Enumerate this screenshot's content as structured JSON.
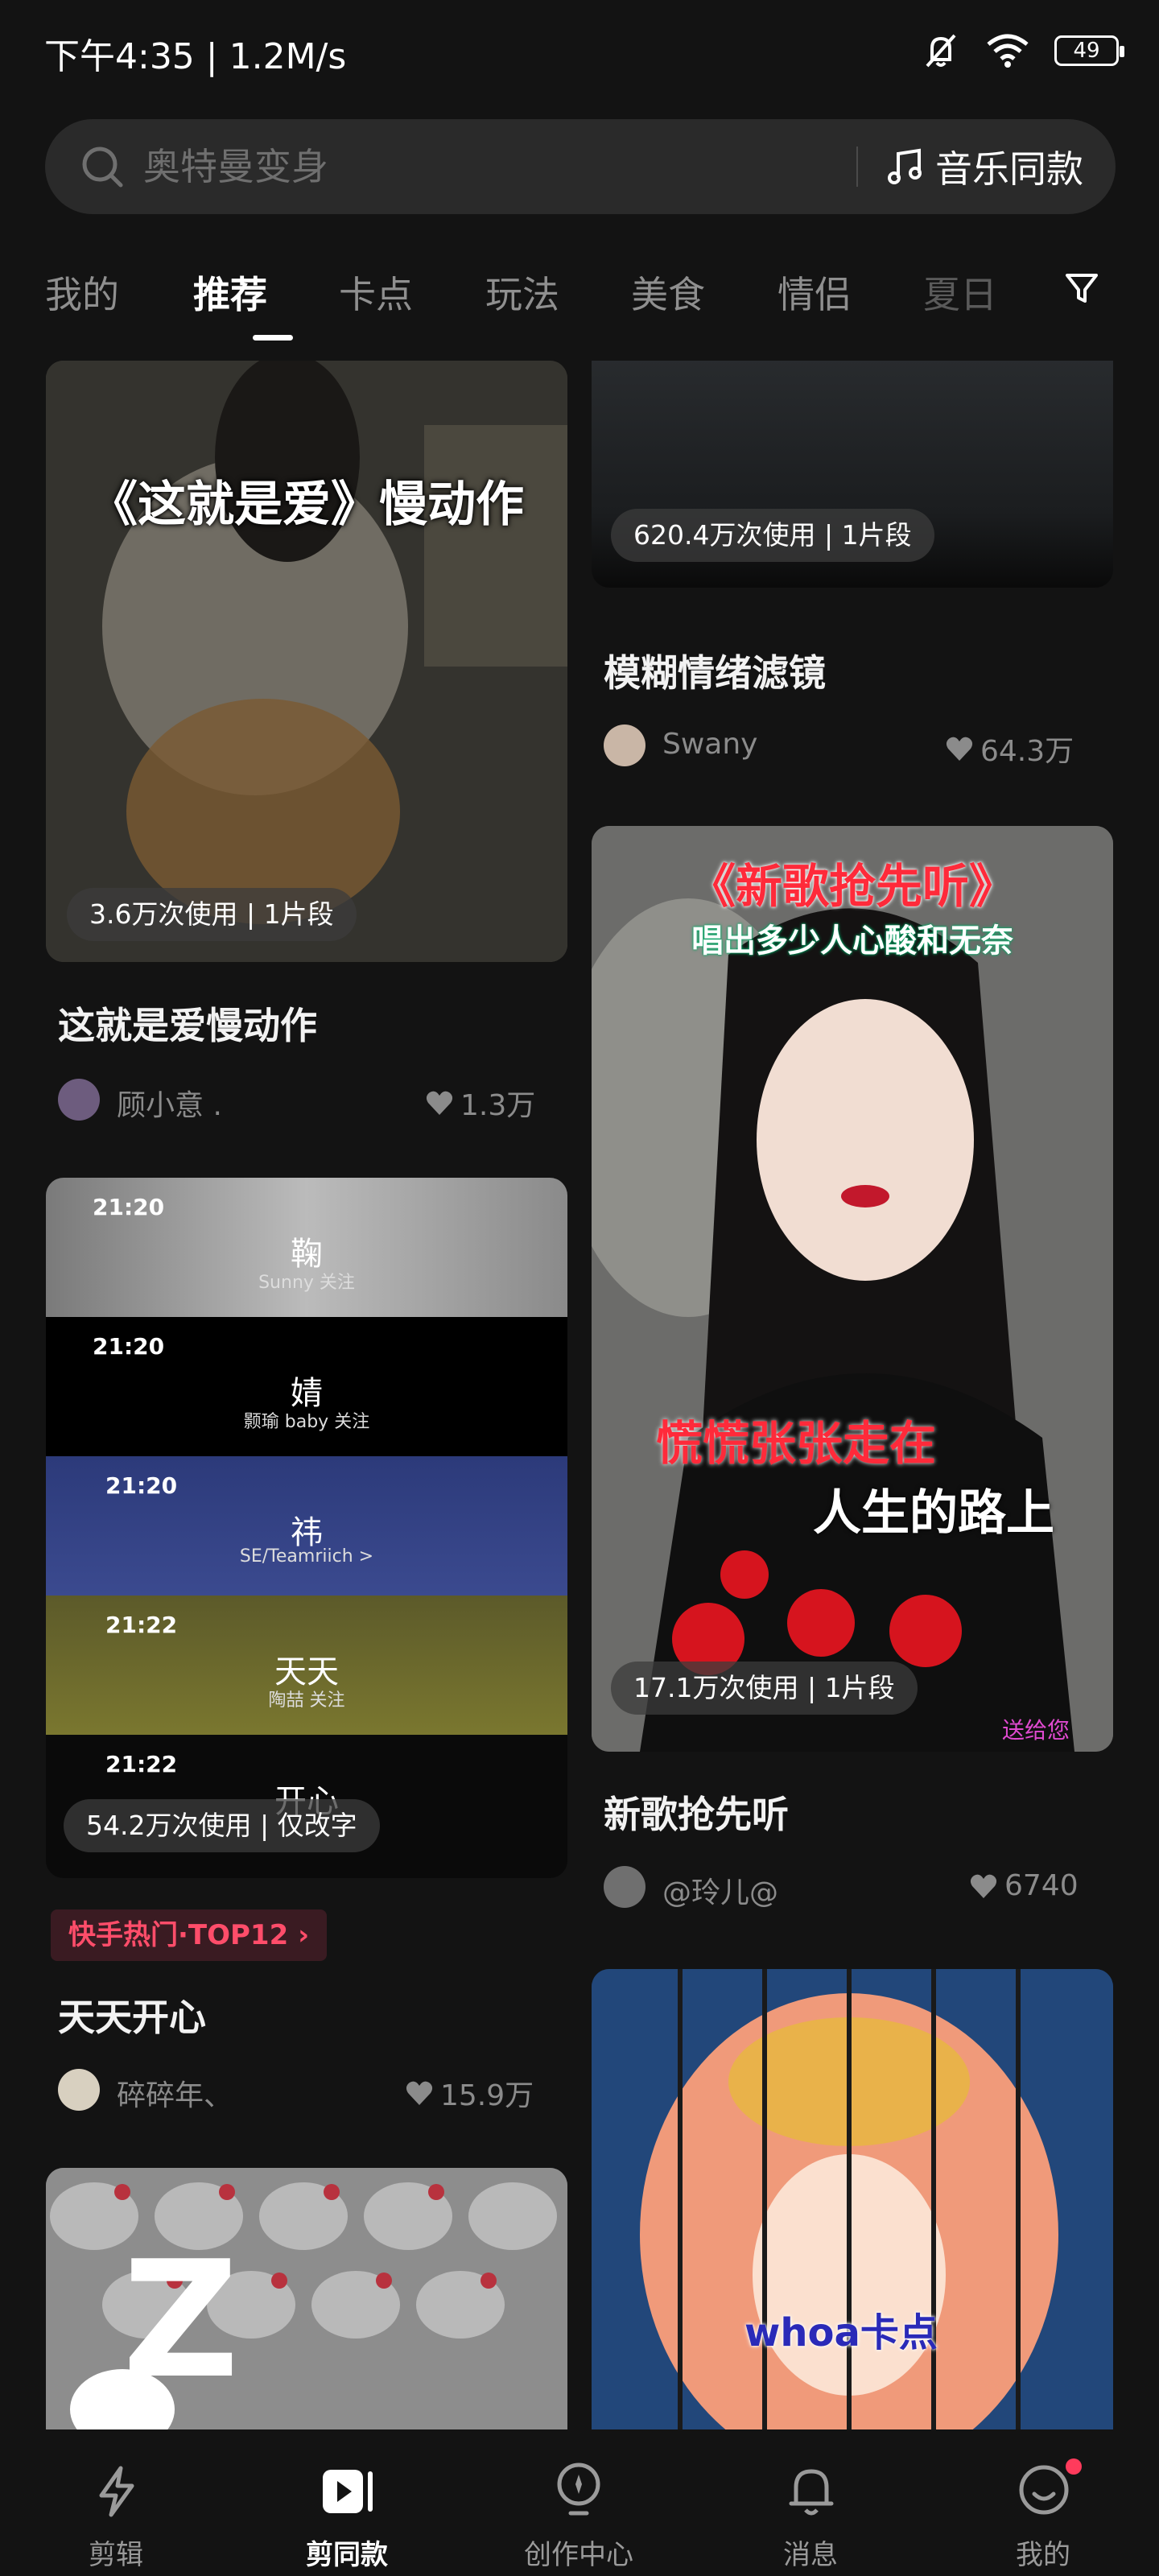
{
  "status_bar": {
    "time": "下午4:35 | 1.2M/s",
    "battery": "49",
    "icons": [
      "mute-bell-icon",
      "wifi-icon",
      "battery-icon"
    ]
  },
  "search": {
    "placeholder": "奥特曼变身",
    "music_label": "音乐同款"
  },
  "tabs": [
    {
      "label": "我的"
    },
    {
      "label": "推荐"
    },
    {
      "label": "卡点"
    },
    {
      "label": "玩法"
    },
    {
      "label": "美食"
    },
    {
      "label": "情侣"
    },
    {
      "label": "夏日"
    }
  ],
  "active_tab": "推荐",
  "cards": {
    "love_slowmo": {
      "overlay": "《这就是爱》慢动作",
      "usage": "3.6万次使用 | 1片段",
      "title": "这就是爱慢动作",
      "author": "顾小意 .",
      "likes": "1.3万"
    },
    "blur_filter": {
      "usage": "620.4万次使用 | 1片段",
      "title": "模糊情绪滤镜",
      "author": "Swany",
      "likes": "64.3万"
    },
    "daily_happy": {
      "screens": [
        {
          "time": "21:20",
          "name": "鞠",
          "sub": "Sunny 关注"
        },
        {
          "time": "21:20",
          "name": "婧",
          "sub": "颢瑜 baby 关注"
        },
        {
          "time": "21:20",
          "name": "祎",
          "sub": "SE/Teamriich >"
        },
        {
          "time": "21:22",
          "name": "天天",
          "sub": "陶喆 关注"
        },
        {
          "time": "21:22",
          "name": "开心",
          "sub": ""
        }
      ],
      "usage": "54.2万次使用 | 仅改字",
      "rank": "快手热门·TOP12",
      "title": "天天开心",
      "author": "碎碎年、",
      "likes": "15.9万"
    },
    "new_song": {
      "overlay_title": "《新歌抢先听》",
      "overlay_sub": "唱出多少人心酸和无奈",
      "lyric1": "慌慌张张走在",
      "lyric2": "人生的路上",
      "watermark": "送给您",
      "usage": "17.1万次使用 | 1片段",
      "title": "新歌抢先听",
      "author": "@玲儿@",
      "likes": "6740"
    },
    "whoa": {
      "overlay": "whoa卡点"
    },
    "kitty": {
      "overlay": "Z"
    }
  },
  "bottom_nav": [
    {
      "label": "剪辑",
      "icon": "lightning-icon"
    },
    {
      "label": "剪同款",
      "icon": "template-icon"
    },
    {
      "label": "创作中心",
      "icon": "bulb-icon"
    },
    {
      "label": "消息",
      "icon": "bell-icon"
    },
    {
      "label": "我的",
      "icon": "smile-icon"
    }
  ],
  "colors": {
    "background": "#131313",
    "accent_red": "#ff3b5c",
    "tag_text": "#ff4d6a"
  }
}
